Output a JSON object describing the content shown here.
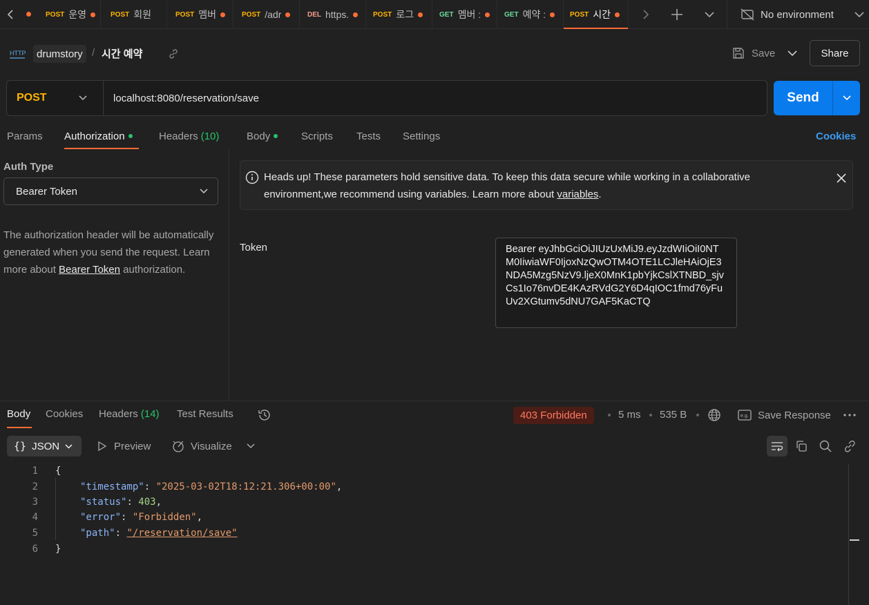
{
  "tabs": [
    {
      "method": "POST",
      "name": "운영",
      "modified": true
    },
    {
      "method": "POST",
      "name": "회원",
      "modified": false
    },
    {
      "method": "POST",
      "name": "멤버",
      "modified": true
    },
    {
      "method": "POST",
      "name": "/adr",
      "modified": true
    },
    {
      "method": "DEL",
      "name": "https.",
      "modified": true
    },
    {
      "method": "POST",
      "name": "로그",
      "modified": true
    },
    {
      "method": "GET",
      "name": "멤버 :",
      "modified": true
    },
    {
      "method": "GET",
      "name": "예약 :",
      "modified": true
    },
    {
      "method": "POST",
      "name": "시간",
      "modified": true,
      "active": true
    }
  ],
  "environment": "No environment",
  "breadcrumb": {
    "workspace": "drumstory",
    "separator": "/",
    "request": "시간 예약",
    "badge": "HTTP"
  },
  "header": {
    "save_label": "Save",
    "share_label": "Share"
  },
  "request": {
    "method": "POST",
    "url": "localhost:8080/reservation/save",
    "send_label": "Send"
  },
  "request_tabs": {
    "params": "Params",
    "authorization": "Authorization",
    "headers": "Headers",
    "headers_count": "(10)",
    "body": "Body",
    "scripts": "Scripts",
    "tests": "Tests",
    "settings": "Settings",
    "cookies": "Cookies"
  },
  "auth": {
    "type_label": "Auth Type",
    "type_value": "Bearer Token",
    "description_before": "The authorization header will be automatically generated when you send the request. Learn more about ",
    "description_link": "Bearer Token",
    "description_after": " authorization.",
    "notice_before": "Heads up! These parameters hold sensitive data. To keep this data secure while working in a collaborative environment,we recommend using variables. Learn more about ",
    "notice_link": "variables",
    "notice_after": ".",
    "token_label": "Token",
    "token_value": "Bearer eyJhbGciOiJIUzUxMiJ9.eyJzdWIiOiI0NTM0IiwiaWF0IjoxNzQwOTM4OTE1LCJleHAiOjE3NDA5Mzg5NzV9.ljeX0MnK1pbYjkCslXTNBD_sjvCs1Io76nvDE4KAzRVdG2Y6D4qIOC1fmd76yFuUv2XGtumv5dNU7GAF5KaCTQ"
  },
  "response": {
    "tabs": {
      "body": "Body",
      "cookies": "Cookies",
      "headers": "Headers",
      "headers_count": "(14)",
      "test_results": "Test Results"
    },
    "status": "403 Forbidden",
    "time": "5 ms",
    "size": "535 B",
    "save_response": "Save Response",
    "format": "JSON",
    "preview": "Preview",
    "visualize": "Visualize",
    "body_lines": [
      {
        "n": "1",
        "text": "{"
      },
      {
        "n": "2",
        "key": "\"timestamp\"",
        "value": "\"2025-03-02T18:12:21.306+00:00\"",
        "type": "str"
      },
      {
        "n": "3",
        "key": "\"status\"",
        "value": "403",
        "type": "num"
      },
      {
        "n": "4",
        "key": "\"error\"",
        "value": "\"Forbidden\"",
        "type": "str"
      },
      {
        "n": "5",
        "key": "\"path\"",
        "value": "\"/reservation/save\"",
        "type": "str"
      },
      {
        "n": "6",
        "text": "}"
      }
    ]
  },
  "colors": {
    "accent": "#ff6c37",
    "send": "#097bed",
    "post": "#ffb400",
    "get": "#6bdd9a",
    "delete": "#f79a8e",
    "error": "#ff7a63"
  }
}
